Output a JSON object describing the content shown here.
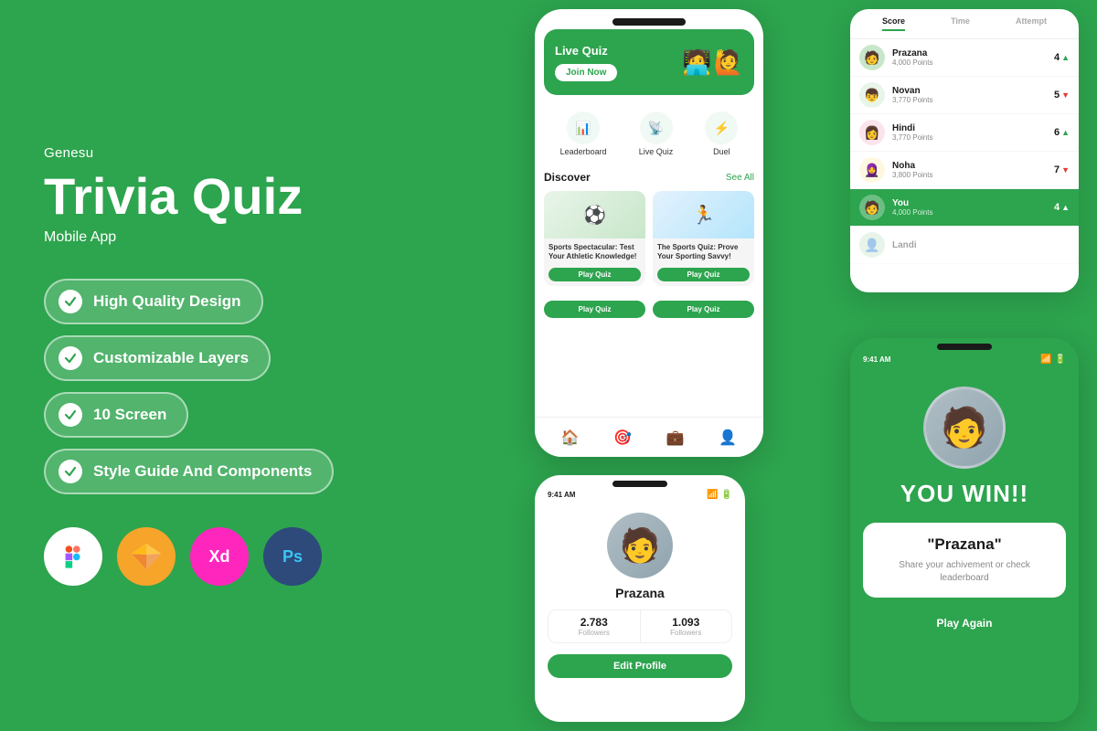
{
  "brand": {
    "name": "Genesu",
    "title": "Trivia Quiz",
    "subtitle": "Mobile App"
  },
  "features": [
    {
      "id": "high-quality",
      "label": "High Quality Design"
    },
    {
      "id": "customizable",
      "label": "Customizable Layers"
    },
    {
      "id": "screens",
      "label": "10 Screen"
    },
    {
      "id": "style-guide",
      "label": "Style Guide And Components"
    }
  ],
  "tools": [
    {
      "id": "figma",
      "label": "Figma",
      "color": "#fff"
    },
    {
      "id": "sketch",
      "label": "Sketch",
      "color": "#f7a42b"
    },
    {
      "id": "xd",
      "label": "XD",
      "color": "#ff26be"
    },
    {
      "id": "ps",
      "label": "Ps",
      "color": "#2d4a7a"
    }
  ],
  "phone1": {
    "live_quiz_title": "Live Quiz",
    "join_now": "Join Now",
    "nav_icons": [
      {
        "label": "Leaderboard",
        "icon": "📊"
      },
      {
        "label": "Live Quiz",
        "icon": "📡"
      },
      {
        "label": "Duel",
        "icon": "⚡"
      }
    ],
    "discover_title": "Discover",
    "see_all": "See All",
    "cards": [
      {
        "text": "Sports Spectacular: Test Your Athletic Knowledge!",
        "btn": "Play Quiz",
        "emoji": "⚽"
      },
      {
        "text": "The Sports Quiz: Prove Your Sporting Savvy!",
        "btn": "Play Quiz",
        "emoji": "🏃"
      }
    ],
    "more_btns": [
      "Play Quiz",
      "Play Quiz"
    ]
  },
  "leaderboard": {
    "tabs": [
      "Score",
      "Time",
      "Attempt"
    ],
    "rows": [
      {
        "name": "Prazana",
        "points": "4,000 Points",
        "rank": 4,
        "arrow": "up"
      },
      {
        "name": "Novan",
        "points": "3,770 Points",
        "rank": 5,
        "arrow": "down"
      },
      {
        "name": "Hindi",
        "points": "3,770 Points",
        "rank": 6,
        "arrow": "up"
      },
      {
        "name": "Noha",
        "points": "3,800 Points",
        "rank": 7,
        "arrow": "down"
      }
    ],
    "you_row": {
      "name": "You",
      "points": "4,000 Points",
      "rank": 4
    }
  },
  "profile": {
    "status_time": "9:41 AM",
    "name": "Prazana",
    "followers": "2.783",
    "following": "1.093",
    "followers_label": "Followers",
    "following_label": "Followers",
    "edit_btn": "Edit Profile"
  },
  "win": {
    "status_time": "9:41 AM",
    "title": "YOU WIN!!",
    "winner_name": "\"Prazana\"",
    "description": "Share your achivement or check leaderboard",
    "play_again_btn": "Play Again"
  }
}
